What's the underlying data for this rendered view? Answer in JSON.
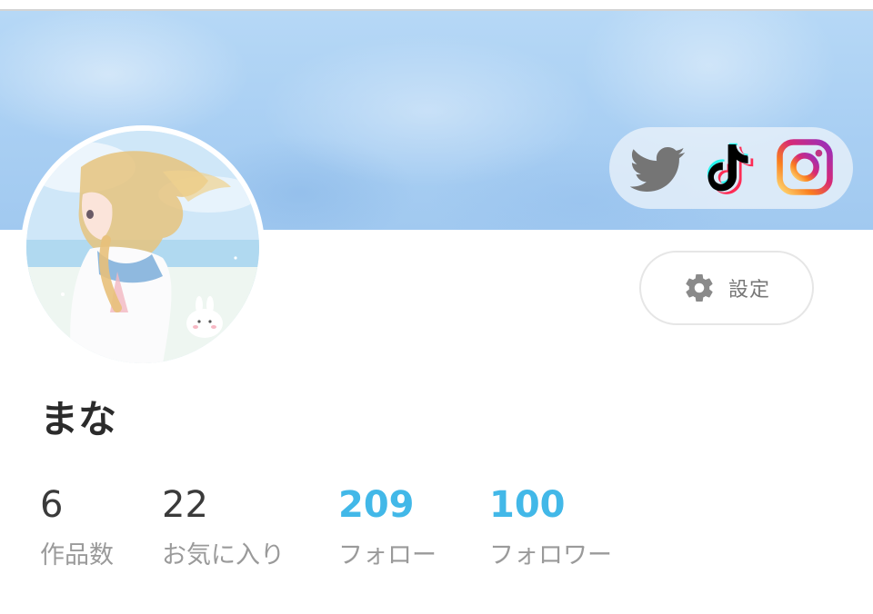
{
  "profile": {
    "name": "まな",
    "settings_label": "設定"
  },
  "social_links": [
    {
      "name": "Twitter",
      "icon": "twitter-bird-icon",
      "color": "#757575"
    },
    {
      "name": "TikTok",
      "icon": "tiktok-note-icon",
      "color": "#000000"
    },
    {
      "name": "Instagram",
      "icon": "instagram-camera-icon",
      "color": "#e1306c"
    }
  ],
  "stats": [
    {
      "value": "6",
      "label": "作品数"
    },
    {
      "value": "22",
      "label": "お気に入り"
    },
    {
      "value": "209",
      "label": "フォロー"
    },
    {
      "value": "100",
      "label": "フォロワー"
    }
  ],
  "colors": {
    "accent": "#42b8e8",
    "cover": "#a9cff3",
    "text_primary": "#2b2b2b",
    "text_secondary": "#9a9a9a"
  }
}
